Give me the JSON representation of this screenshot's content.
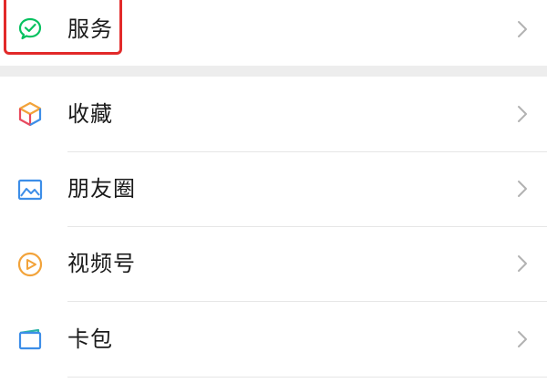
{
  "menu": {
    "items": [
      {
        "label": "服务",
        "icon": "service-check-icon"
      },
      {
        "label": "收藏",
        "icon": "favorites-cube-icon"
      },
      {
        "label": "朋友圈",
        "icon": "moments-picture-icon"
      },
      {
        "label": "视频号",
        "icon": "channels-play-icon"
      },
      {
        "label": "卡包",
        "icon": "card-wallet-icon"
      }
    ]
  },
  "colors": {
    "highlight": "#e22a2a",
    "service_green": "#07c160",
    "section_gap": "#ededed",
    "chevron": "#b2b2b2"
  }
}
